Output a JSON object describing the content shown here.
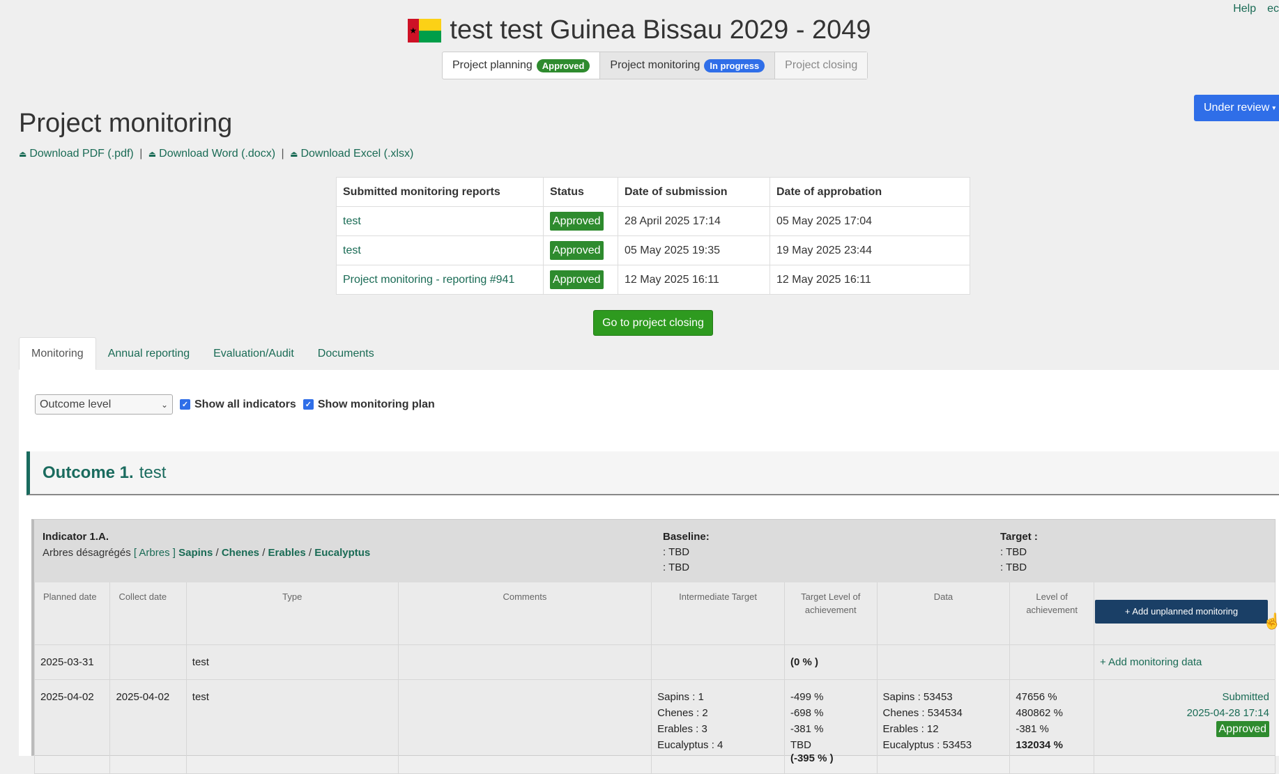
{
  "header": {
    "links": [
      "Help",
      "ec"
    ],
    "title": "test test Guinea Bissau 2029 - 2049",
    "steps": [
      {
        "label": "Project planning",
        "badge": "Approved"
      },
      {
        "label": "Project monitoring",
        "badge": "In progress"
      },
      {
        "label": "Project closing"
      }
    ],
    "review_button": "Under review"
  },
  "page": {
    "title": "Project monitoring",
    "downloads": [
      "Download PDF (.pdf)",
      "Download Word (.docx)",
      "Download Excel (.xlsx)"
    ],
    "download_sep": "|"
  },
  "reports": {
    "headers": [
      "Submitted monitoring reports",
      "Status",
      "Date of submission",
      "Date of approbation"
    ],
    "rows": [
      {
        "name": "test",
        "status": "Approved",
        "submitted": "28 April 2025 17:14",
        "approved": "05 May 2025 17:04"
      },
      {
        "name": "test",
        "status": "Approved",
        "submitted": "05 May 2025 19:35",
        "approved": "19 May 2025 23:44"
      },
      {
        "name": "Project monitoring - reporting #941",
        "status": "Approved",
        "submitted": "12 May 2025 16:11",
        "approved": "12 May 2025 16:11"
      }
    ]
  },
  "go_closing": "Go to project closing",
  "tabs": [
    "Monitoring",
    "Annual reporting",
    "Evaluation/Audit",
    "Documents"
  ],
  "filters": {
    "level": "Outcome level",
    "show_all": "Show all indicators",
    "show_plan": "Show monitoring plan"
  },
  "outcome": {
    "number": "Outcome 1.",
    "name": "test"
  },
  "indicator": {
    "title": "Indicator 1.A.",
    "desc": "Arbres désagrégés",
    "group": "[ Arbres ]",
    "items": [
      "Sapins",
      "Chenes",
      "Erables",
      "Eucalyptus"
    ],
    "item_sep": "/",
    "baseline_label": "Baseline:",
    "baseline": [
      ": TBD",
      ": TBD"
    ],
    "target_label": "Target :",
    "target": [
      ": TBD",
      ": TBD"
    ],
    "columns": [
      "Planned date",
      "Collect date",
      "Type",
      "Comments",
      "Intermediate Target",
      "Target Level of achievement",
      "Data",
      "Level of achievement"
    ],
    "add_unplanned": "+ Add unplanned monitoring",
    "rows": [
      {
        "planned": "2025-03-31",
        "collect": "",
        "type": "test",
        "comments": "",
        "inter": [],
        "tla": [
          "(0 % )"
        ],
        "data": [],
        "loa": [],
        "action": "+ Add monitoring data"
      },
      {
        "planned": "2025-04-02",
        "collect": "2025-04-02",
        "type": "test",
        "comments": "",
        "inter": [
          "Sapins : 1",
          "Chenes : 2",
          "Erables : 3",
          "Eucalyptus : 4"
        ],
        "tla": [
          "-499 %",
          "-698 %",
          "-381 %",
          "TBD",
          "(-395 % )"
        ],
        "data": [
          "Sapins : 53453",
          "Chenes : 534534",
          "Erables : 12",
          "Eucalyptus : 53453"
        ],
        "loa": [
          "47656 %",
          "480862 %",
          "-381 %",
          "132034 %"
        ],
        "status": "Submitted",
        "date": "2025-04-28 17:14",
        "badge": "Approved"
      }
    ]
  },
  "colors": {
    "accent": "#1a6b55",
    "approved": "#2e8b2e",
    "primary": "#2f6ee8",
    "dark_button": "#1a3f66"
  }
}
